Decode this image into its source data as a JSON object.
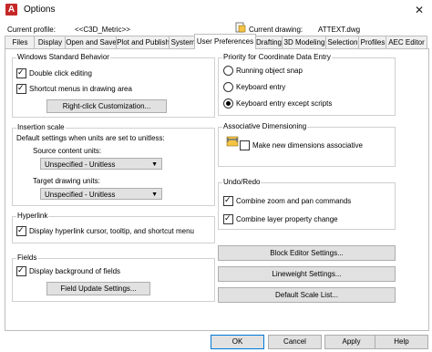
{
  "window": {
    "title": "Options",
    "close_glyph": "✕"
  },
  "header": {
    "profile_label": "Current profile:",
    "profile_value": "<<C3D_Metric>>",
    "drawing_label": "Current drawing:",
    "drawing_value": "ATTEXT.dwg"
  },
  "tabs": [
    "Files",
    "Display",
    "Open and Save",
    "Plot and Publish",
    "System",
    "User Preferences",
    "Drafting",
    "3D Modeling",
    "Selection",
    "Profiles",
    "AEC Editor"
  ],
  "active_tab": "User Preferences",
  "windows_behavior": {
    "title": "Windows Standard Behavior",
    "double_click": "Double click editing",
    "shortcut_menus": "Shortcut menus in drawing area",
    "customize_button": "Right-click Customization..."
  },
  "insertion_scale": {
    "title": "Insertion scale",
    "description": "Default settings when units are set to unitless:",
    "source_label": "Source content units:",
    "source_value": "Unspecified - Unitless",
    "target_label": "Target drawing units:",
    "target_value": "Unspecified - Unitless"
  },
  "hyperlink": {
    "title": "Hyperlink",
    "display_option": "Display hyperlink cursor, tooltip, and shortcut menu"
  },
  "fields": {
    "title": "Fields",
    "display_background": "Display background of fields",
    "update_button": "Field Update Settings..."
  },
  "coordinate_priority": {
    "title": "Priority for Coordinate Data Entry",
    "options": [
      "Running object snap",
      "Keyboard entry",
      "Keyboard entry except scripts"
    ],
    "selected": "Keyboard entry except scripts"
  },
  "associative_dimensioning": {
    "title": "Associative Dimensioning",
    "option": "Make new dimensions associative"
  },
  "undo_redo": {
    "title": "Undo/Redo",
    "combine_zoom": "Combine zoom and pan commands",
    "combine_layer": "Combine layer property change"
  },
  "side_buttons": {
    "block_editor": "Block Editor Settings...",
    "lineweight": "Lineweight Settings...",
    "scale_list": "Default Scale List..."
  },
  "footer": {
    "ok": "OK",
    "cancel": "Cancel",
    "apply": "Apply",
    "help": "Help"
  },
  "colors": {
    "accent": "#0078d7",
    "app_icon": "#c62828"
  }
}
